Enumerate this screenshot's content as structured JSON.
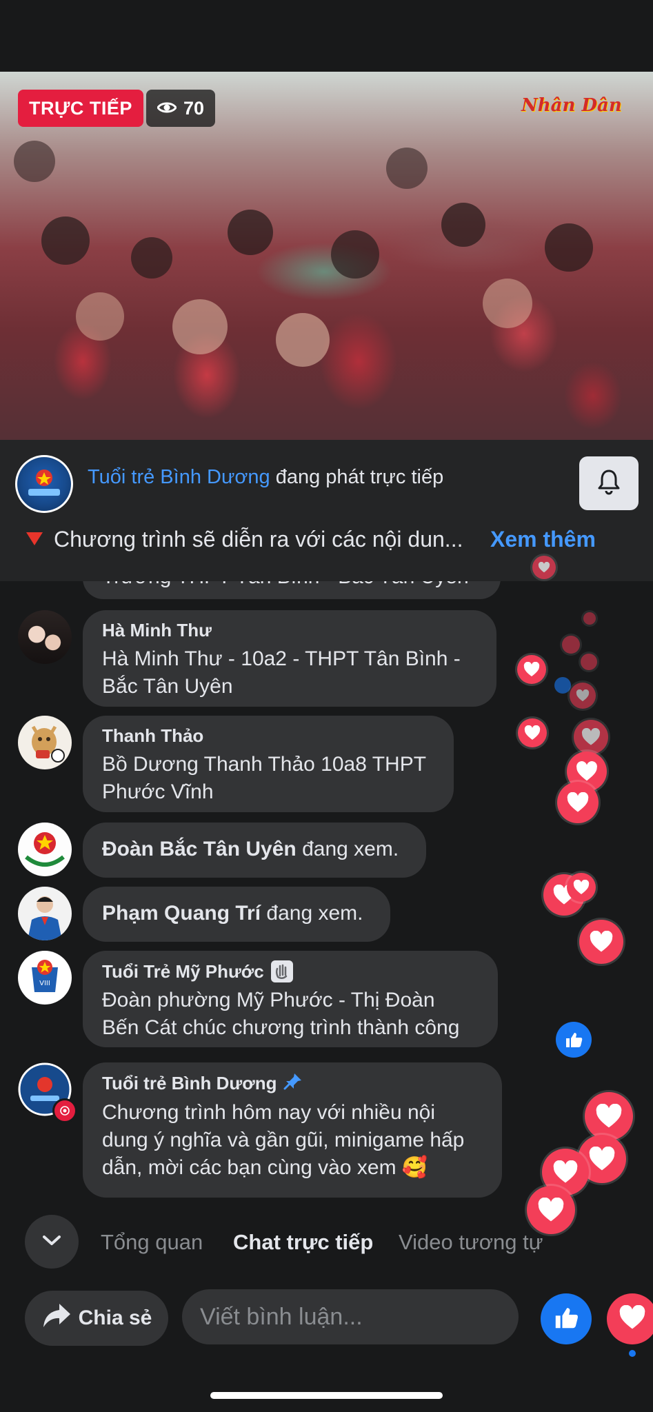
{
  "video": {
    "live_label": "TRỰC TIẾP",
    "viewer_count": "70",
    "watermark": "Nhân Dân"
  },
  "channel": {
    "name": "Tuổi trẻ Bình Dương",
    "status_text": "đang phát trực tiếp",
    "description": "Chương trình sẽ diễn ra với các nội dun...",
    "see_more": "Xem thêm",
    "name_color": "#4599ff"
  },
  "chat": {
    "partial_message": "Trường THPT Tân Bình - Bắc Tân Uyên",
    "messages": [
      {
        "author": "Hà Minh Thư",
        "text_lines": [
          "Hà Minh Thư - 10a2 - THPT Tân Bình -",
          "Bắc Tân Uyên"
        ]
      },
      {
        "author": "Thanh Thảo",
        "text_lines": [
          "Bồ Dương Thanh Thảo 10a8 THPT",
          "Phước Vĩnh"
        ]
      },
      {
        "name": "Đoàn Bắc Tân Uyên",
        "status": "đang xem."
      },
      {
        "name": "Phạm Quang Trí",
        "status": "đang xem."
      },
      {
        "author": "Tuổi Trẻ Mỹ Phước",
        "author_icon": "waving-hand-icon",
        "text_lines": [
          "Đoàn phường Mỹ Phước - Thị Đoàn",
          "Bến Cát chúc chương trình thành công"
        ]
      },
      {
        "author": "Tuổi trẻ Bình Dương",
        "author_icon": "pin-icon",
        "text_lines": [
          "Chương trình hôm nay với nhiều nội",
          "dung ý nghĩa và gần gũi, minigame hấp",
          "dẫn, mời các bạn cùng vào xem 🥰"
        ]
      }
    ]
  },
  "tabs": [
    {
      "label": "Tổng quan",
      "active": false
    },
    {
      "label": "Chat trực tiếp",
      "active": true
    },
    {
      "label": "Video tương tự",
      "active": false
    }
  ],
  "bottom_bar": {
    "share_label": "Chia sẻ",
    "comment_placeholder": "Viết bình luận..."
  },
  "colors": {
    "live_red": "#e41e3f",
    "like_blue": "#1877f2",
    "love_red": "#f33e58",
    "background": "#18191a",
    "bubble": "#333436"
  }
}
